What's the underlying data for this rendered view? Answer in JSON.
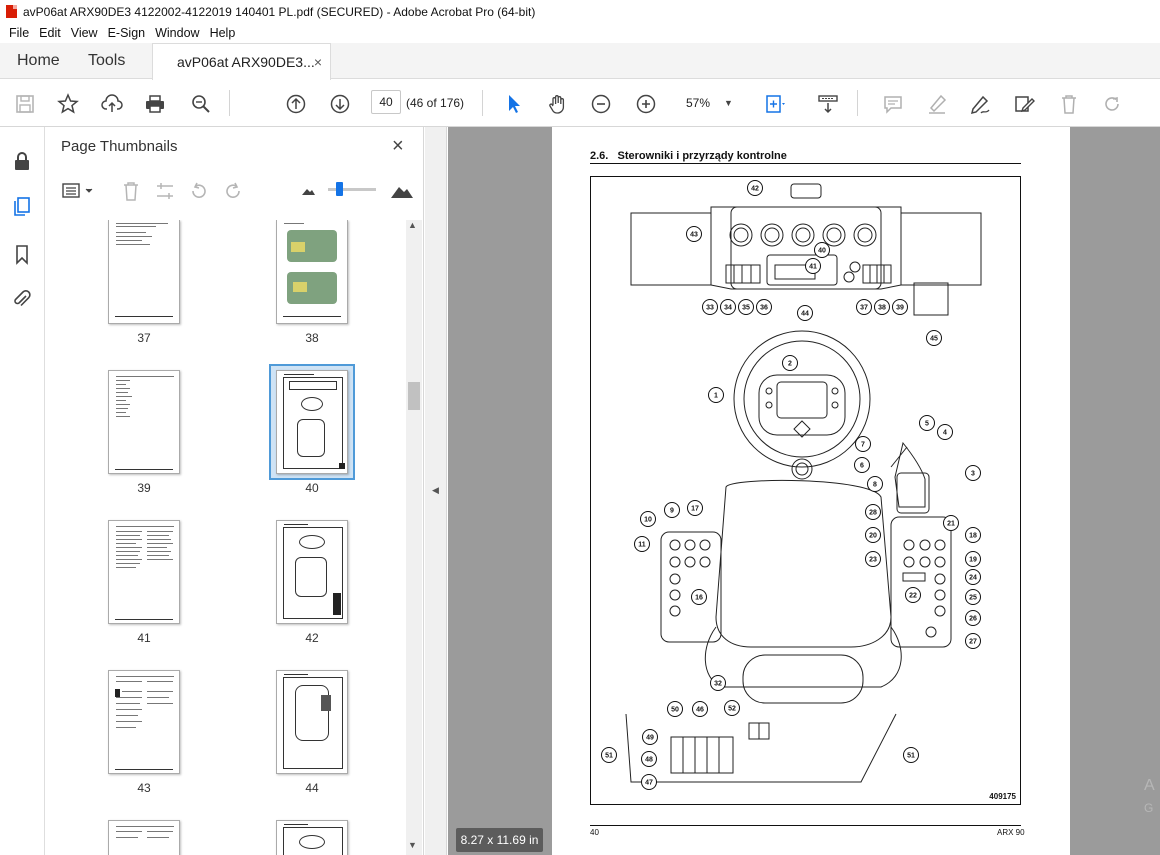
{
  "window": {
    "title": "avP06at ARX90DE3 4122002-4122019 140401 PL.pdf (SECURED) - Adobe Acrobat Pro (64-bit)"
  },
  "menu": [
    "File",
    "Edit",
    "View",
    "E-Sign",
    "Window",
    "Help"
  ],
  "tabs": {
    "home": "Home",
    "tools": "Tools",
    "document": "avP06at ARX90DE3...",
    "close": "×"
  },
  "toolbar": {
    "page_number": "40",
    "page_of": "(46 of 176)",
    "zoom": "57%",
    "icons": [
      "save-icon",
      "bookmark-star-icon",
      "upload-icon",
      "print-icon",
      "find-icon",
      "previous-page-icon",
      "next-page-icon",
      "select-cursor-icon",
      "hand-icon",
      "zoom-out-icon",
      "zoom-in-icon",
      "fit-page-icon",
      "scroll-mode-icon",
      "comment-icon",
      "highlight-icon",
      "sign-icon",
      "fill-sign-icon",
      "delete-icon",
      "rotate-icon"
    ]
  },
  "rail_icons": [
    "lock-icon",
    "page-thumbnails-icon",
    "bookmark-icon",
    "attachment-icon"
  ],
  "thumbnails_panel": {
    "title": "Page Thumbnails",
    "close": "×",
    "pages": [
      {
        "label": "37"
      },
      {
        "label": "38"
      },
      {
        "label": "39"
      },
      {
        "label": "40",
        "selected": true
      },
      {
        "label": "41"
      },
      {
        "label": "42"
      },
      {
        "label": "43"
      },
      {
        "label": "44"
      }
    ]
  },
  "document": {
    "section_number": "2.6.",
    "section_title": "Sterowniki i przyrządy kontrolne",
    "figure_number": "409175",
    "footer_left": "40",
    "footer_right": "ARX 90",
    "page_size": "8.27 x 11.69 in",
    "callouts": [
      "1",
      "2",
      "3",
      "4",
      "5",
      "6",
      "7",
      "8",
      "9",
      "10",
      "11",
      "16",
      "17",
      "18",
      "19",
      "20",
      "21",
      "22",
      "23",
      "24",
      "25",
      "26",
      "27",
      "28",
      "32",
      "33",
      "34",
      "35",
      "36",
      "37",
      "38",
      "39",
      "40",
      "41",
      "42",
      "43",
      "44",
      "45",
      "46",
      "47",
      "48",
      "49",
      "50",
      "51",
      "52"
    ]
  },
  "overlay": {
    "line1": "A",
    "line2": "G"
  }
}
